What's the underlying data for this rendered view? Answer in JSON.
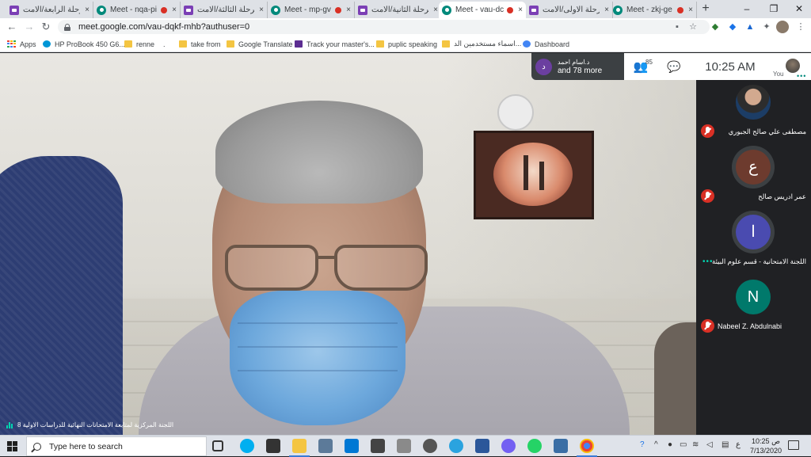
{
  "browser": {
    "tabs": [
      {
        "title": "المرحلة الرابعة/الامت",
        "icon": "classroom-icon",
        "recording": false,
        "active": false
      },
      {
        "title": "Meet - nqa-pi",
        "icon": "meet-icon",
        "recording": true,
        "active": false
      },
      {
        "title": "المرحلة الثالثة/الامت",
        "icon": "classroom-icon",
        "recording": false,
        "active": false
      },
      {
        "title": "Meet - mp-gv",
        "icon": "meet-icon",
        "recording": true,
        "active": false
      },
      {
        "title": "المرحلة الثانية/الامت",
        "icon": "classroom-icon",
        "recording": false,
        "active": false
      },
      {
        "title": "Meet - vau-dc",
        "icon": "meet-icon",
        "recording": true,
        "active": true
      },
      {
        "title": "المرحلة الاولى/الامت",
        "icon": "classroom-icon",
        "recording": false,
        "active": false
      },
      {
        "title": "Meet - zkj-ge",
        "icon": "meet-icon",
        "recording": true,
        "active": false
      }
    ],
    "tab_close_glyph": "×",
    "new_tab_glyph": "+",
    "window_controls": {
      "minimize": "–",
      "maximize": "❐",
      "close": "✕"
    },
    "url": "meet.google.com/vau-dqkf-mhb?authuser=0",
    "bookmarks": [
      {
        "label": "Apps",
        "icon": "apps-icon"
      },
      {
        "label": "HP ProBook 450 G6...",
        "icon": "hp-icon"
      },
      {
        "label": "renne",
        "icon": "folder-icon"
      },
      {
        "label": ".",
        "icon": "none"
      },
      {
        "label": "take from",
        "icon": "folder-icon"
      },
      {
        "label": "Google Translate",
        "icon": "folder-icon"
      },
      {
        "label": "Track your master's...",
        "icon": "m-icon"
      },
      {
        "label": "puplic speaking",
        "icon": "folder-icon"
      },
      {
        "label": "اسماء مستخدمين الد...",
        "icon": "document-icon"
      },
      {
        "label": "Dashboard",
        "icon": "google-icon"
      }
    ]
  },
  "meet": {
    "presenter_chip": {
      "avatar_letter": "د",
      "name": "د.اسام احمد",
      "more": "and 78 more"
    },
    "participant_count": "85",
    "time": "10:25 AM",
    "you_label": "You",
    "participants": [
      {
        "name": "مصطفى علي صالح الجبوري",
        "avatar": "photo",
        "letter": "",
        "color": "",
        "mic_off": true,
        "talking": false
      },
      {
        "name": "عمر ادريس صالح",
        "avatar": "letter",
        "letter": "ع",
        "color": "#6d3b2e",
        "mic_off": true,
        "talking": false
      },
      {
        "name": "اللجنة الامتحانية - قسم علوم البيئة",
        "avatar": "letter",
        "letter": "ا",
        "color": "#4a4bb0",
        "mic_off": false,
        "talking": true
      },
      {
        "name": "Nabeel Z. Abdulnabi",
        "avatar": "letter",
        "letter": "N",
        "color": "#00796b",
        "mic_off": true,
        "talking": false
      }
    ],
    "caption": "اللجنة المركزية لمتابعة الامتحانات النهائية للدراسات الاولية 8"
  },
  "taskbar": {
    "search_placeholder": "Type here to search",
    "clock_time": "10:25 ص",
    "clock_date": "7/13/2020",
    "lang": "ع"
  }
}
